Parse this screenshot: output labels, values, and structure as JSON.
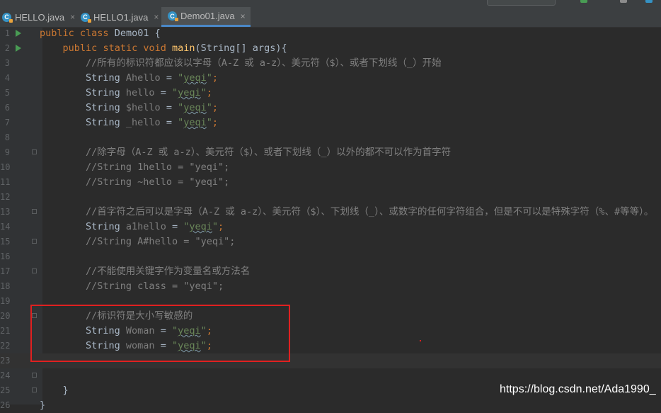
{
  "tabs": [
    {
      "label": "HELLO.java",
      "active": false
    },
    {
      "label": "HELLO1.java",
      "active": false
    },
    {
      "label": "Demo01.java",
      "active": true
    }
  ],
  "tab_close": "×",
  "file_icon": "java-class-icon",
  "editor": {
    "current_line": 23,
    "lines": [
      {
        "n": "1",
        "code": "public class Demo01 {"
      },
      {
        "n": "2",
        "code": "    public static void main(String[] args){"
      },
      {
        "n": "3",
        "code": "        //所有的标识符都应该以字母（A-Z 或 a-z）、美元符（$）、或者下划线（_）开始"
      },
      {
        "n": "4",
        "code": "        String Ahello = \"yeqi\";"
      },
      {
        "n": "5",
        "code": "        String hello = \"yeqi\";"
      },
      {
        "n": "6",
        "code": "        String $hello = \"yeqi\";"
      },
      {
        "n": "7",
        "code": "        String _hello = \"yeqi\";"
      },
      {
        "n": "8",
        "code": ""
      },
      {
        "n": "9",
        "code": "        //除字母（A-Z 或 a-z）、美元符（$）、或者下划线（_）以外的都不可以作为首字符"
      },
      {
        "n": "10",
        "code": "        //String 1hello = \"yeqi\";"
      },
      {
        "n": "11",
        "code": "        //String ~hello = \"yeqi\";"
      },
      {
        "n": "12",
        "code": ""
      },
      {
        "n": "13",
        "code": "        //首字符之后可以是字母（A-Z 或 a-z）、美元符（$）、下划线（_）、或数字的任何字符组合，但是不可以是特殊字符（%、#等等）。"
      },
      {
        "n": "14",
        "code": "        String a1hello = \"yeqi\";"
      },
      {
        "n": "15",
        "code": "        //String A#hello = \"yeqi\";"
      },
      {
        "n": "16",
        "code": ""
      },
      {
        "n": "17",
        "code": "        //不能使用关键字作为变量名或方法名"
      },
      {
        "n": "18",
        "code": "        //String class = \"yeqi\";"
      },
      {
        "n": "19",
        "code": ""
      },
      {
        "n": "20",
        "code": "        //标识符是大小写敏感的"
      },
      {
        "n": "21",
        "code": "        String Woman = \"yeqi\";"
      },
      {
        "n": "22",
        "code": "        String woman = \"yeqi\";"
      },
      {
        "n": "23",
        "code": ""
      },
      {
        "n": "24",
        "code": ""
      },
      {
        "n": "25",
        "code": "    }"
      },
      {
        "n": "26",
        "code": "}"
      }
    ]
  },
  "watermark": "https://blog.csdn.net/Ada1990_",
  "colors": {
    "background": "#2b2b2b",
    "gutter": "#313335",
    "keyword": "#cc7832",
    "string": "#6a8759",
    "comment": "#808080",
    "method": "#ffc66d",
    "highlight_box": "#e02020",
    "tab_accent": "#4a88c7"
  }
}
